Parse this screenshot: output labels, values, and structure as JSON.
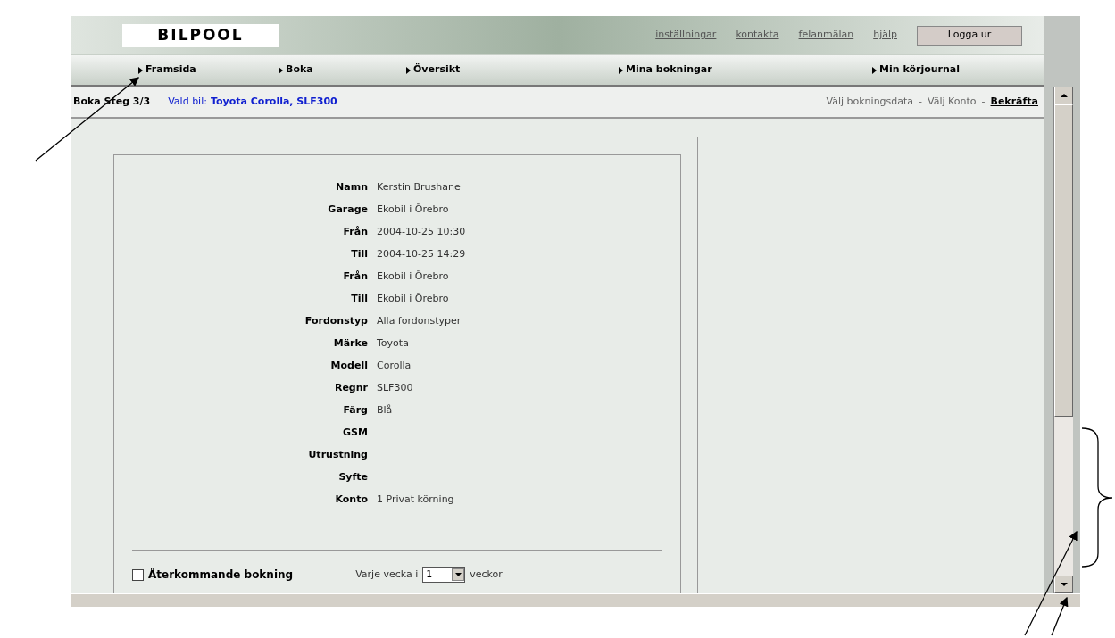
{
  "header": {
    "logo": "BILPOOL",
    "links": [
      "inställningar",
      "kontakta",
      "felanmälan",
      "hjälp"
    ],
    "logout": "Logga ur"
  },
  "nav": [
    "Framsida",
    "Boka",
    "Översikt",
    "Mina bokningar",
    "Min körjournal"
  ],
  "step_bar": {
    "step": "Boka Steg 3/3",
    "car_label": "Vald bil:",
    "car": "Toyota Corolla, SLF300",
    "steps": [
      {
        "label": "Välj bokningsdata",
        "selected": false
      },
      {
        "label": "Välj Konto",
        "selected": false
      },
      {
        "label": "Bekräfta",
        "selected": true
      }
    ],
    "separator": "-"
  },
  "details": [
    {
      "label": "Namn",
      "value": "Kerstin Brushane"
    },
    {
      "label": "Garage",
      "value": "Ekobil i Örebro"
    },
    {
      "label": "Från",
      "value": "2004-10-25 10:30"
    },
    {
      "label": "Till",
      "value": "2004-10-25 14:29"
    },
    {
      "label": "Från",
      "value": "Ekobil i Örebro"
    },
    {
      "label": "Till",
      "value": "Ekobil i Örebro"
    },
    {
      "label": "Fordonstyp",
      "value": "Alla fordonstyper"
    },
    {
      "label": "Märke",
      "value": "Toyota"
    },
    {
      "label": "Modell",
      "value": "Corolla"
    },
    {
      "label": "Regnr",
      "value": "SLF300"
    },
    {
      "label": "Färg",
      "value": "Blå"
    },
    {
      "label": "GSM"
    },
    {
      "label": "Utrustning"
    },
    {
      "label": "Syfte"
    },
    {
      "label": "Konto",
      "value": "1 Privat körning"
    }
  ],
  "recurring": {
    "label": "Återkommande bokning",
    "checked": false,
    "prefix": "Varje vecka i",
    "select_value": "1",
    "suffix": "veckor"
  }
}
